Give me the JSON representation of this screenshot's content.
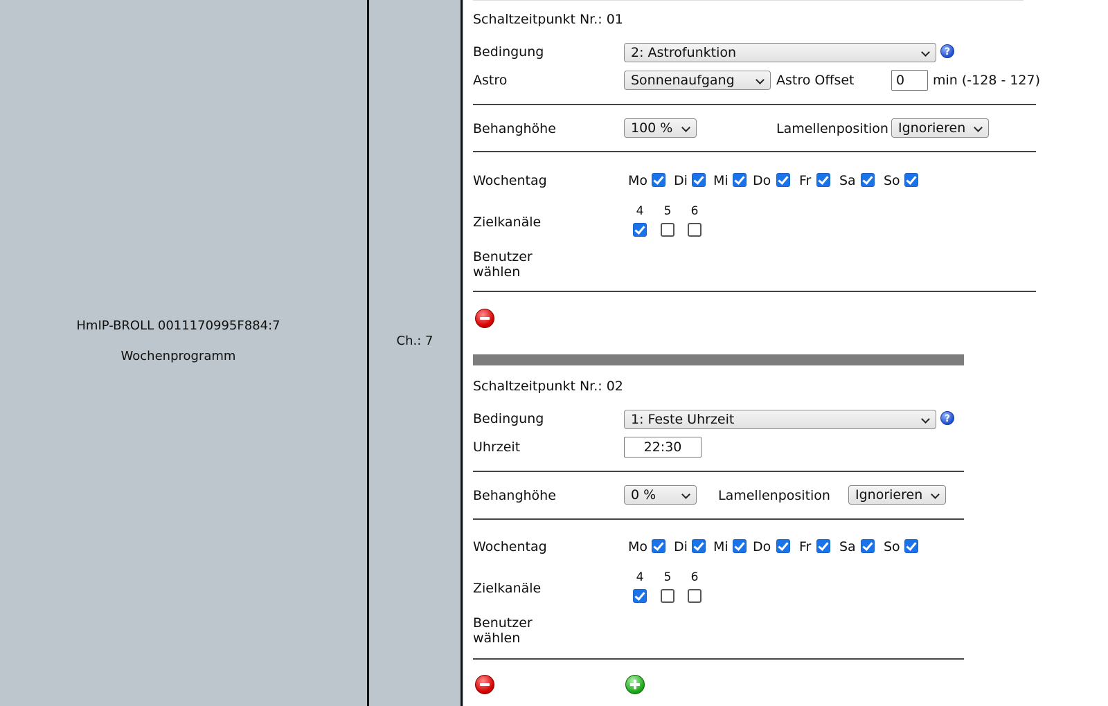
{
  "device": {
    "name": "HmIP-BROLL 0011170995F884:7",
    "program": "Wochenprogramm",
    "channel": "Ch.: 7"
  },
  "labels": {
    "bedingung": "Bedingung",
    "astro": "Astro",
    "astro_offset": "Astro Offset",
    "uhrzeit": "Uhrzeit",
    "behanghoehe": "Behanghöhe",
    "lamellenposition": "Lamellenposition",
    "wochentag": "Wochentag",
    "zielkanaele": "Zielkanäle",
    "benutzer": "Benutzer",
    "waehlen": "wählen",
    "help_icon": "?"
  },
  "days": [
    "Mo",
    "Di",
    "Mi",
    "Do",
    "Fr",
    "Sa",
    "So"
  ],
  "channels": [
    "4",
    "5",
    "6"
  ],
  "schedules": [
    {
      "heading": "Schaltzeitpunkt Nr.: 01",
      "condition": "2: Astrofunktion",
      "astro": "Sonnenaufgang",
      "astro_offset": "0",
      "offset_range": "min (-128 - 127)",
      "level": "100 %",
      "slat": "Ignorieren",
      "days_checked": [
        true,
        true,
        true,
        true,
        true,
        true,
        true
      ],
      "channels_checked": [
        true,
        false,
        false
      ]
    },
    {
      "heading": "Schaltzeitpunkt Nr.: 02",
      "condition": "1: Feste Uhrzeit",
      "time": "22:30",
      "level": "0 %",
      "slat": "Ignorieren",
      "days_checked": [
        true,
        true,
        true,
        true,
        true,
        true,
        true
      ],
      "channels_checked": [
        true,
        false,
        false
      ]
    }
  ],
  "colors": {
    "panel_bg": "#bdc6cc",
    "checkbox_blue": "#1a73e8",
    "separator": "#7d7d7d",
    "remove_red": "#d40000",
    "add_green": "#1fa81c"
  }
}
